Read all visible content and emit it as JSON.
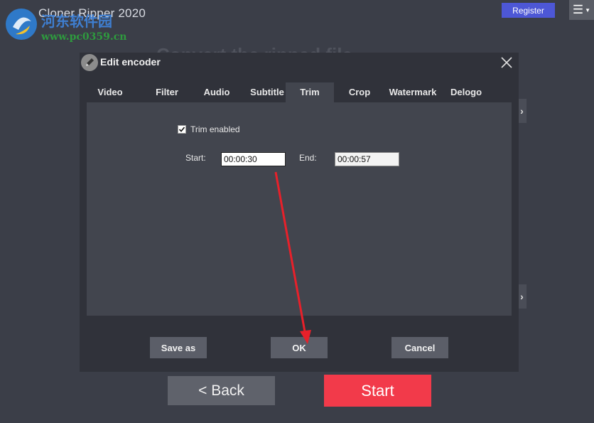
{
  "app": {
    "title": "Cloner Ripper 2020",
    "watermark_cn": "河东软件园",
    "watermark_url": "www.pc0359.cn",
    "register_label": "Register",
    "background_heading": "Convert the ripped file"
  },
  "dialog": {
    "title": "Edit encoder",
    "tabs": [
      {
        "label": "Video"
      },
      {
        "label": "Filter"
      },
      {
        "label": "Audio"
      },
      {
        "label": "Subtitle"
      },
      {
        "label": "Trim"
      },
      {
        "label": "Crop"
      },
      {
        "label": "Watermark"
      },
      {
        "label": "Delogo"
      }
    ],
    "active_tab": "Trim",
    "trim": {
      "enabled_label": "Trim enabled",
      "enabled": true,
      "start_label": "Start:",
      "start_value": "00:00:30",
      "end_label": "End:",
      "end_value": "00:00:57"
    },
    "buttons": {
      "save_as": "Save as",
      "ok": "OK",
      "cancel": "Cancel"
    }
  },
  "footer": {
    "back_label": "<  Back",
    "start_label": "Start"
  },
  "colors": {
    "background": "#3b3e48",
    "dialog": "#30323a",
    "panel": "#42454e",
    "register": "#4d57d6",
    "start": "#f23a4a",
    "annotation_arrow": "#e8202a"
  }
}
